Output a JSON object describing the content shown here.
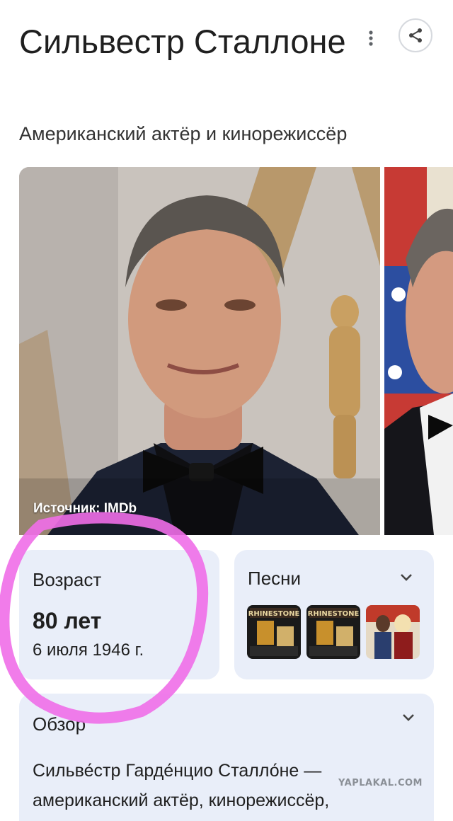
{
  "header": {
    "title": "Сильвестр Сталлоне",
    "subtitle": "Американский актёр и кинорежиссёр"
  },
  "icons": {
    "more": "more-vert-icon",
    "share": "share-icon"
  },
  "images": {
    "main_source": "Источник: IMDb"
  },
  "age_card": {
    "label": "Возраст",
    "value": "80 лет",
    "birth_date": "6 июля 1946 г."
  },
  "songs_card": {
    "label": "Песни"
  },
  "overview_card": {
    "label": "Обзор",
    "text": "Сильве́стр Гарде́нцио Сталло́не — американский актёр, кинорежиссёр,"
  },
  "watermark": "YAPLAKAL.COM",
  "colors": {
    "card_bg": "#e9eef9",
    "highlight": "#f06ee8"
  }
}
